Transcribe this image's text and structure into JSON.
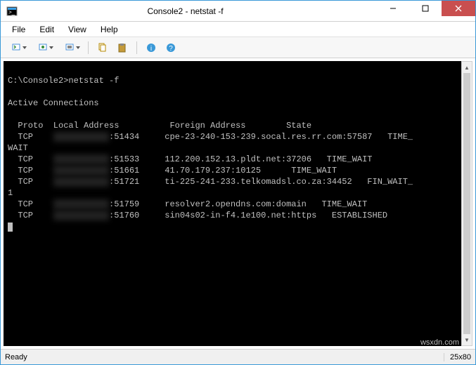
{
  "window": {
    "title": "Console2 - netstat  -f"
  },
  "menubar": {
    "items": [
      "File",
      "Edit",
      "View",
      "Help"
    ]
  },
  "toolbar": {
    "icons": [
      "new-tab-icon",
      "run-icon",
      "settings-icon",
      "copy-icon",
      "paste-icon",
      "info-icon",
      "help-icon"
    ]
  },
  "terminal": {
    "prompt_path": "C:\\Console2>",
    "command": "netstat -f",
    "heading": "Active Connections",
    "columns": "  Proto  Local Address          Foreign Address        State",
    "rows": [
      {
        "proto": "TCP",
        "local_host": "REDACTED",
        "local_port": ":51434",
        "foreign": "cpe-23-240-153-239.socal.res.rr.com:57587",
        "state": "TIME_WAIT",
        "wrap": ""
      },
      {
        "proto": "TCP",
        "local_host": "REDACTED",
        "local_port": ":51533",
        "foreign": "112.200.152.13.pldt.net:37206",
        "state": "TIME_WAIT",
        "wrap": ""
      },
      {
        "proto": "TCP",
        "local_host": "REDACTED",
        "local_port": ":51661",
        "foreign": "41.70.179.237:10125",
        "state": "TIME_WAIT",
        "wrap": ""
      },
      {
        "proto": "TCP",
        "local_host": "REDACTED",
        "local_port": ":51721",
        "foreign": "ti-225-241-233.telkomadsl.co.za:34452",
        "state": "FIN_WAIT_1",
        "wrap": "1"
      },
      {
        "proto": "TCP",
        "local_host": "REDACTED",
        "local_port": ":51759",
        "foreign": "resolver2.opendns.com:domain",
        "state": "TIME_WAIT",
        "wrap": ""
      },
      {
        "proto": "TCP",
        "local_host": "REDACTED",
        "local_port": ":51760",
        "foreign": "sin04s02-in-f4.1e100.net:https",
        "state": "ESTABLISHED",
        "wrap": ""
      }
    ]
  },
  "statusbar": {
    "left": "Ready",
    "right": "25x80"
  },
  "watermark": "wsxdn.com"
}
